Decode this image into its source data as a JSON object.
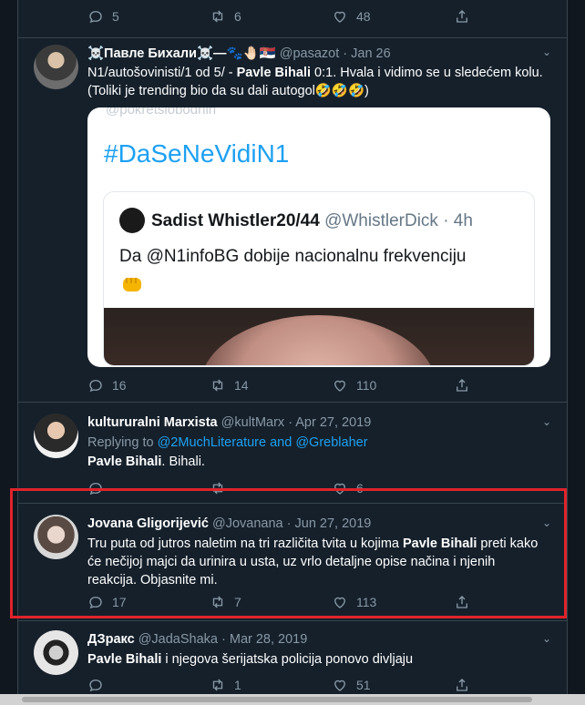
{
  "top_actions": {
    "reply": "5",
    "retweet": "6",
    "like": "48"
  },
  "tweets": [
    {
      "name": "☠️Павле Бихали☠️—🐾🤚🏻🇷🇸",
      "handle": "@pasazot",
      "date": "Jan 26",
      "text_pre": "N1/autošovinisti/1 od 5/ - ",
      "text_bold": "Pavle Bihali",
      "text_post": " 0:1. Hvala i vidimo se u sledećem kolu. (Toliki je trending bio da su dali autogol🤣🤣🤣)",
      "card": {
        "ghost_text": "@pokretslobodnih",
        "hashtag": "#DaSeNeVidiN1",
        "quoted_name": "Sadist Whistler20/44",
        "quoted_handle": "@WhistlerDick · 4h",
        "quoted_text": "Da @N1infoBG dobije nacionalnu frekvenciju",
        "emoji": "fist-emoji"
      },
      "reply": "16",
      "retweet": "14",
      "like": "110"
    },
    {
      "name": "kultururalni Marxista",
      "handle": "@kultMarx",
      "date": "Apr 27, 2019",
      "replying_label": "Replying to",
      "replying_to": "@2MuchLiterature and @Greblaher",
      "text_bold": "Pavle Bihali",
      "text_post": ". Bihali.",
      "reply": "",
      "retweet": "",
      "like": "6"
    },
    {
      "name": "Jovana Gligorijević",
      "handle": "@Jovanana",
      "date": "Jun 27, 2019",
      "text_pre": "Tru puta od jutros naletim na tri različita tvita u kojima ",
      "text_bold": "Pavle Bihali",
      "text_post": " preti kako će nečijoj majci da urinira u usta, uz vrlo detaljne opise načina i njenih reakcija. Objasnite mi.",
      "reply": "17",
      "retweet": "7",
      "like": "113"
    },
    {
      "name": "ДЗракс",
      "handle": "@JadaShaka",
      "date": "Mar 28, 2019",
      "text_bold": "Pavle Bihali",
      "text_post": " i njegova šerijatska policija ponovo divljaju",
      "reply": "",
      "retweet": "1",
      "like": "51"
    }
  ],
  "colors": {
    "background": "#15202b",
    "accent": "#1da1f2",
    "highlight": "#e0232b",
    "muted": "#8899a6"
  }
}
